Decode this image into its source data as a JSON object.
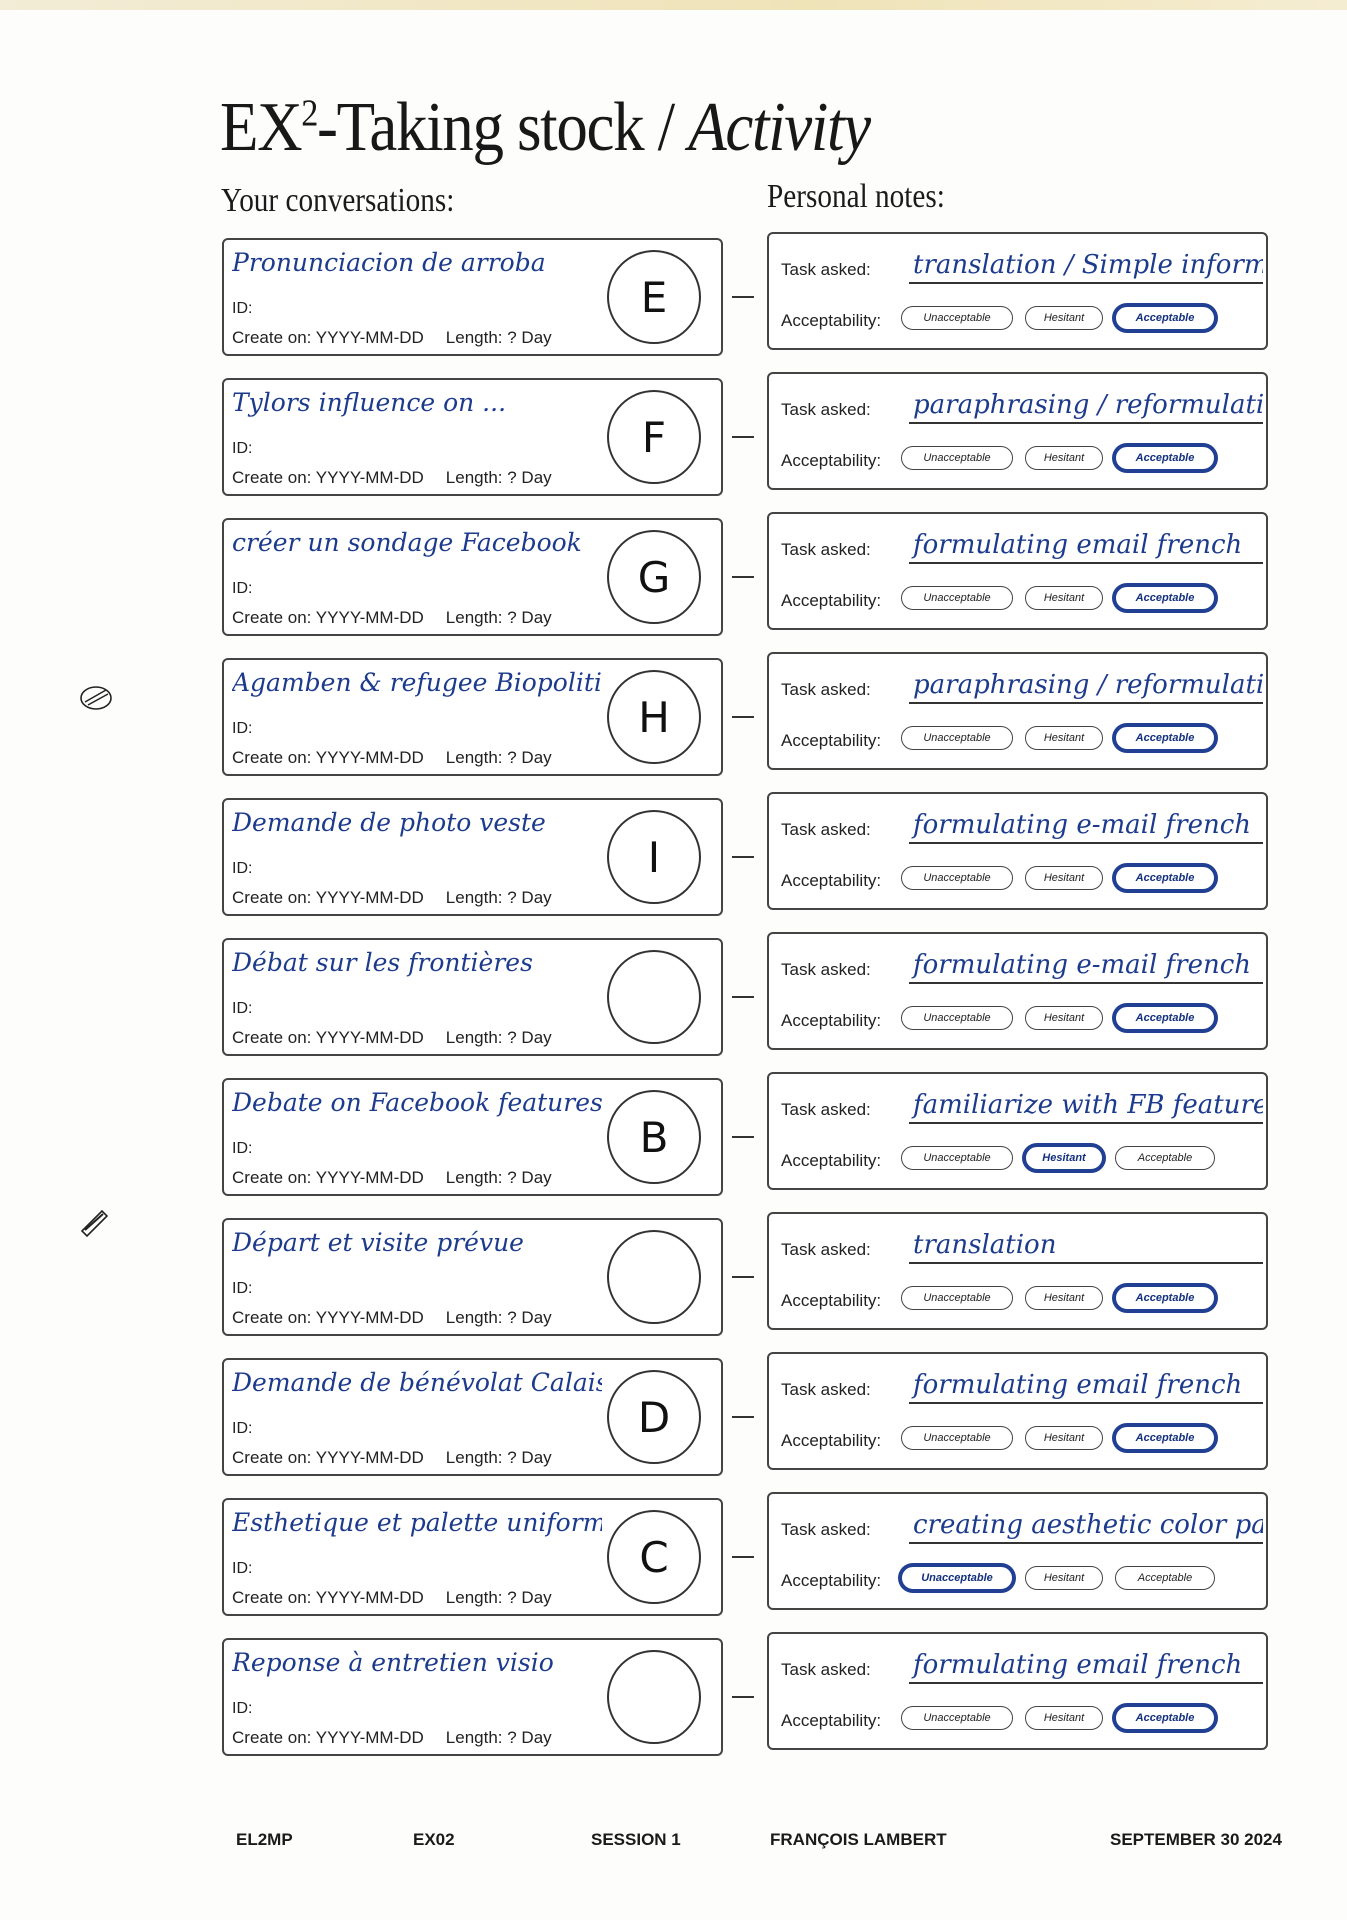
{
  "heading": {
    "title_prefix": "EX",
    "title_sup": "2",
    "title_main": "-Taking stock / ",
    "title_italic": "Activity",
    "conversations_label": "Your conversations:",
    "notes_label": "Personal notes:"
  },
  "labels": {
    "id": "ID:",
    "create_on": "Create on: YYYY-MM-DD",
    "length": "Length: ? Day",
    "task_asked": "Task asked:",
    "acceptability": "Acceptability:",
    "opt_unacceptable": "Unacceptable",
    "opt_hesitant": "Hesitant",
    "opt_acceptable": "Acceptable"
  },
  "rows": [
    {
      "conversation": "Pronunciacion de arroba",
      "letter": "E",
      "task": "translation / Simple information",
      "acceptability": "Acceptable"
    },
    {
      "conversation": "Tylors influence on ...",
      "letter": "F",
      "task": "paraphrasing / reformulating",
      "acceptability": "Acceptable"
    },
    {
      "conversation": "créer un sondage Facebook",
      "letter": "G",
      "task": "formulating email french",
      "acceptability": "Acceptable"
    },
    {
      "conversation": "Agamben & refugee Biopolitics",
      "letter": "H",
      "task": "paraphrasing / reformulating",
      "acceptability": "Acceptable"
    },
    {
      "conversation": "Demande de photo veste",
      "letter": "I",
      "task": "formulating e-mail french",
      "acceptability": "Acceptable"
    },
    {
      "conversation": "Débat sur les frontières",
      "letter": "",
      "task": "formulating e-mail french",
      "acceptability": "Acceptable"
    },
    {
      "conversation": "Debate on Facebook features",
      "letter": "B",
      "task": "familiarize with FB features",
      "acceptability": "Hesitant"
    },
    {
      "conversation": "Départ et visite prévue",
      "letter": "",
      "task": "translation",
      "acceptability": "Acceptable"
    },
    {
      "conversation": "Demande de bénévolat Calais",
      "letter": "D",
      "task": "formulating email french",
      "acceptability": "Acceptable"
    },
    {
      "conversation": "Esthetique et palette uniform",
      "letter": "C",
      "task": "creating aesthetic color pallette",
      "acceptability": "Unacceptable"
    },
    {
      "conversation": "Reponse à entretien visio",
      "letter": "",
      "task": "formulating email french",
      "acceptability": "Acceptable"
    }
  ],
  "footer": {
    "code": "EL2MP",
    "exercise": "EX02",
    "session": "SESSION 1",
    "author": "FRANÇOIS LAMBERT",
    "date": "SEPTEMBER 30 2024"
  },
  "colors": {
    "ink_blue": "#1d3b8c",
    "print_black": "#1a1a1a",
    "paper": "#fdfdfc"
  }
}
